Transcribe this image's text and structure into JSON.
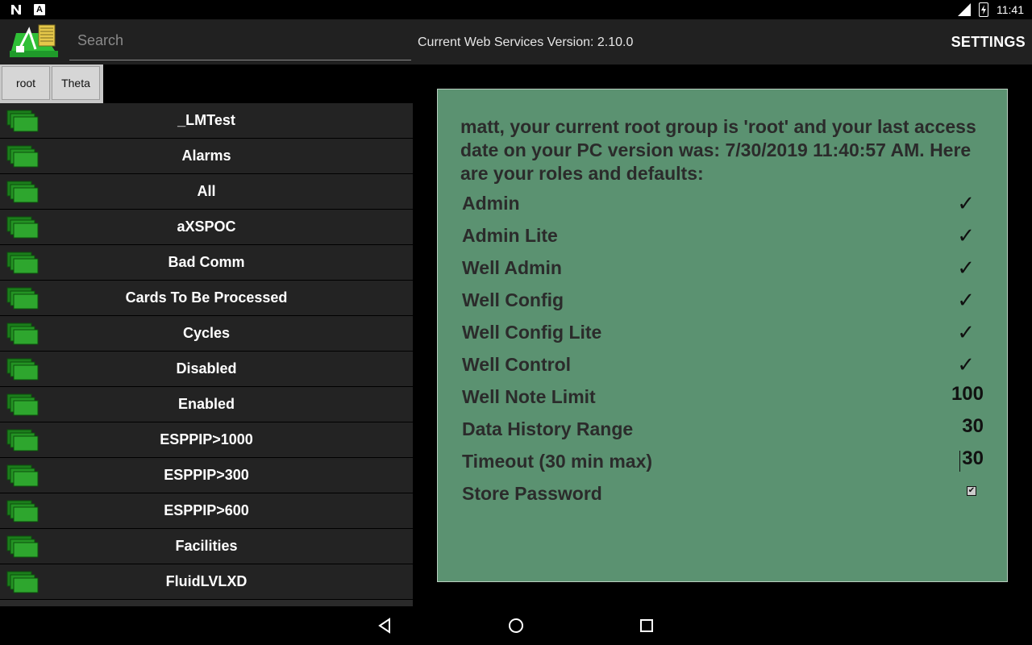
{
  "status_bar": {
    "time": "11:41",
    "network": "LTE"
  },
  "header": {
    "search_placeholder": "Search",
    "version_text": "Current Web Services Version: 2.10.0",
    "settings_label": "SETTINGS"
  },
  "breadcrumb": [
    "root",
    "Theta"
  ],
  "groups": [
    "_LMTest",
    "Alarms",
    "All",
    "aXSPOC",
    "Bad Comm",
    "Cards To Be Processed",
    "Cycles",
    "Disabled",
    "Enabled",
    "ESPPIP>1000",
    "ESPPIP>300",
    "ESPPIP>600",
    "Facilities",
    "FluidLVLXD"
  ],
  "info": {
    "intro": "matt, your current root group is 'root' and your last access date on your PC version was: 7/30/2019 11:40:57 AM. Here are your roles and defaults:",
    "roles": [
      {
        "name": "Admin",
        "value": "✓"
      },
      {
        "name": "Admin Lite",
        "value": "✓"
      },
      {
        "name": "Well Admin",
        "value": "✓"
      },
      {
        "name": "Well Config",
        "value": "✓"
      },
      {
        "name": "Well Config Lite",
        "value": "✓"
      },
      {
        "name": "Well Control",
        "value": "✓"
      },
      {
        "name": "Well Note Limit",
        "value": "100"
      },
      {
        "name": "Data History Range",
        "value": "30"
      },
      {
        "name": "Timeout (30 min max)",
        "value": "30"
      },
      {
        "name": "Store Password",
        "value": "checked"
      }
    ]
  },
  "colors": {
    "panel": "#5b9271",
    "folder": "#2e9e2e",
    "row": "#232323"
  }
}
